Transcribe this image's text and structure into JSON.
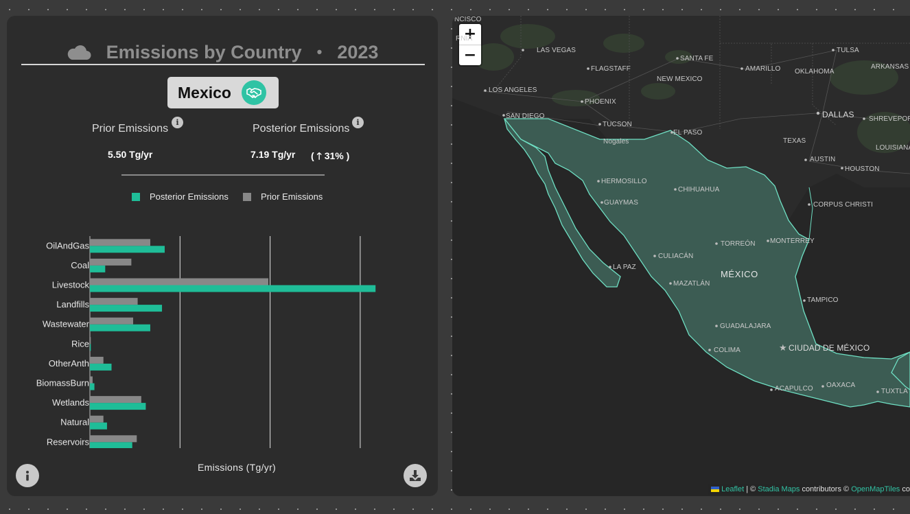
{
  "panel": {
    "title": "Emissions by Country",
    "separator": "•",
    "year": "2023",
    "country": "Mexico",
    "prior_label": "Prior Emissions",
    "posterior_label": "Posterior Emissions",
    "prior_value": "5.50 Tg/yr",
    "posterior_value": "7.19 Tg/yr",
    "change": "( 🡑 31% )",
    "info_glyph": "i",
    "legend": {
      "posterior": "Posterior Emissions",
      "prior": "Prior Emissions"
    },
    "x_axis_title": "Emissions (Tg/yr)",
    "icons": {
      "title": "cloud-icon",
      "country_badge": "handshake-icon",
      "info_button": "info-icon",
      "download_button": "download-icon"
    }
  },
  "chart_data": {
    "type": "bar",
    "orientation": "horizontal",
    "categories": [
      "OilAndGas",
      "Coal",
      "Livestock",
      "Landfills",
      "Wastewater",
      "Rice",
      "OtherAnth",
      "BiomassBurn",
      "Wetlands",
      "Natural",
      "Reservoirs"
    ],
    "series": [
      {
        "name": "Prior Emissions",
        "color": "#888888",
        "values": [
          0.67,
          0.46,
          1.98,
          0.53,
          0.48,
          0.01,
          0.15,
          0.03,
          0.57,
          0.15,
          0.52
        ]
      },
      {
        "name": "Posterior Emissions",
        "color": "#1fbd98",
        "values": [
          0.83,
          0.17,
          3.17,
          0.8,
          0.67,
          0.01,
          0.24,
          0.05,
          0.62,
          0.19,
          0.47
        ]
      }
    ],
    "xlim": [
      0,
      3.2
    ],
    "xticks": [
      "0",
      "1",
      "2",
      "3"
    ],
    "xlabel": "Emissions (Tg/yr)",
    "grid": true,
    "legend_position": "top"
  },
  "map": {
    "zoom_in": "+",
    "zoom_out": "−",
    "highlight_color": "#3c5c53",
    "labels": [
      {
        "t": "NCISCO",
        "cls": ""
      },
      {
        "t": "RNIA",
        "cls": ""
      },
      {
        "t": "LAS VEGAS",
        "cls": ""
      },
      {
        "t": "FLAGSTAFF",
        "cls": ""
      },
      {
        "t": "SANTA FE",
        "cls": ""
      },
      {
        "t": "AMARILLO",
        "cls": ""
      },
      {
        "t": "OKLAHOMA",
        "cls": ""
      },
      {
        "t": "TULSA",
        "cls": ""
      },
      {
        "t": "ARKANSAS",
        "cls": ""
      },
      {
        "t": "LOS ANGELES",
        "cls": ""
      },
      {
        "t": "NEW MEXICO",
        "cls": ""
      },
      {
        "t": "PHOENIX",
        "cls": ""
      },
      {
        "t": "DALLAS",
        "cls": "big"
      },
      {
        "t": "SHREVEPOR",
        "cls": ""
      },
      {
        "t": "SAN DIEGO",
        "cls": ""
      },
      {
        "t": "TUCSON",
        "cls": ""
      },
      {
        "t": "EL PASO",
        "cls": ""
      },
      {
        "t": "Nogales",
        "cls": ""
      },
      {
        "t": "TEXAS",
        "cls": ""
      },
      {
        "t": "LOUISIANA",
        "cls": ""
      },
      {
        "t": "AUSTIN",
        "cls": ""
      },
      {
        "t": "HOUSTON",
        "cls": ""
      },
      {
        "t": "HERMOSILLO",
        "cls": ""
      },
      {
        "t": "CHIHUAHUA",
        "cls": ""
      },
      {
        "t": "GUAYMAS",
        "cls": ""
      },
      {
        "t": "CORPUS CHRISTI",
        "cls": ""
      },
      {
        "t": "TORREÓN",
        "cls": ""
      },
      {
        "t": "MONTERREY",
        "cls": ""
      },
      {
        "t": "CULIACÁN",
        "cls": ""
      },
      {
        "t": "LA PAZ",
        "cls": ""
      },
      {
        "t": "MÉXICO",
        "cls": "country"
      },
      {
        "t": "MAZATLÁN",
        "cls": ""
      },
      {
        "t": "TAMPICO",
        "cls": ""
      },
      {
        "t": "GUADALAJARA",
        "cls": ""
      },
      {
        "t": "CIUDAD DE MÉXICO",
        "cls": "big"
      },
      {
        "t": "COLIMA",
        "cls": ""
      },
      {
        "t": "ACAPULCO",
        "cls": ""
      },
      {
        "t": "OAXACA",
        "cls": ""
      },
      {
        "t": "TUXTLA",
        "cls": ""
      }
    ],
    "attribution": {
      "leaflet": "Leaflet",
      "sep": " | © ",
      "stadia": "Stadia Maps",
      "contrib": " contributors © ",
      "omt": "OpenMapTiles",
      "tail": " co"
    }
  }
}
